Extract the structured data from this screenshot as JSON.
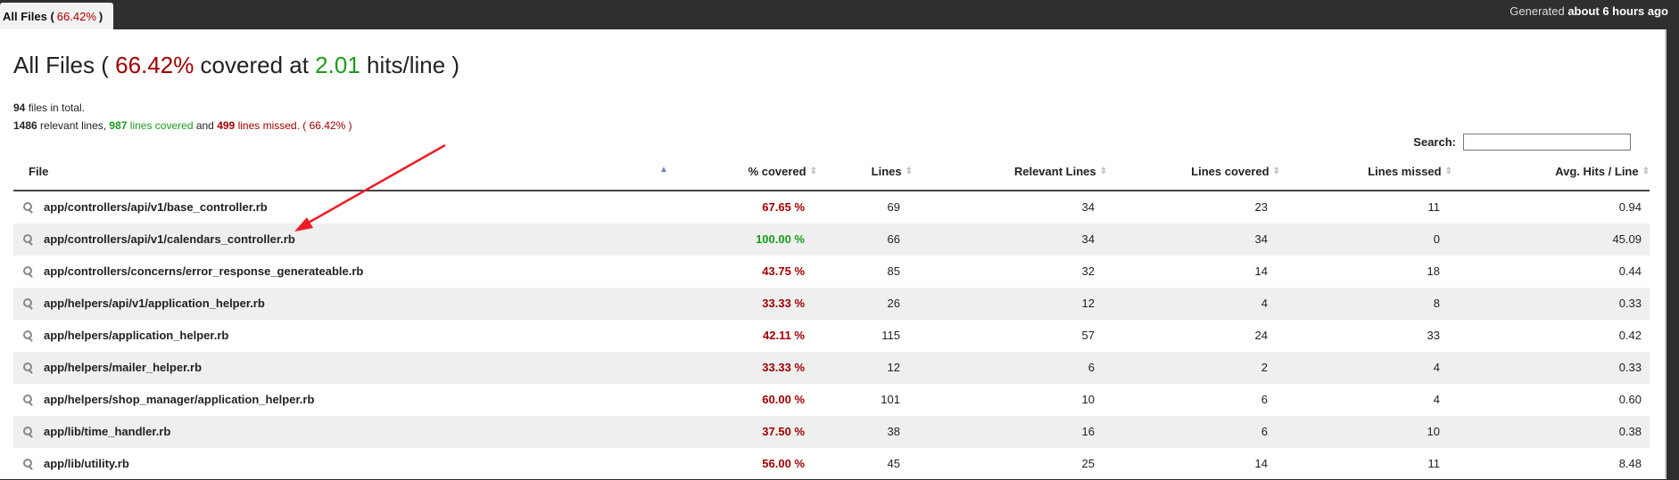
{
  "tab": {
    "label_prefix": "All Files (",
    "percent": "66.42%",
    "label_suffix": ")"
  },
  "generated": {
    "prefix": "Generated",
    "when": "about 6 hours ago"
  },
  "title": {
    "prefix": "All Files ( ",
    "percent": "66.42%",
    "middle": " covered at ",
    "hits": "2.01",
    "suffix": " hits/line )"
  },
  "summary": {
    "files_count": "94",
    "files_text": " files in total.",
    "relevant": "1486",
    "relevant_text": " relevant lines, ",
    "covered": "987",
    "covered_text": " lines covered",
    "and_text": " and ",
    "missed": "499",
    "missed_text": " lines missed.",
    "percent_text": " ( 66.42% )"
  },
  "search": {
    "label": "Search:",
    "value": ""
  },
  "columns": [
    "File",
    "% covered",
    "Lines",
    "Relevant Lines",
    "Lines covered",
    "Lines missed",
    "Avg. Hits / Line"
  ],
  "rows": [
    {
      "file": "app/controllers/api/v1/base_controller.rb",
      "covered": "67.65 %",
      "lines": "69",
      "relevant": "34",
      "lines_covered": "23",
      "missed": "11",
      "avg": "0.94"
    },
    {
      "file": "app/controllers/api/v1/calendars_controller.rb",
      "covered": "100.00 %",
      "lines": "66",
      "relevant": "34",
      "lines_covered": "34",
      "missed": "0",
      "avg": "45.09"
    },
    {
      "file": "app/controllers/concerns/error_response_generateable.rb",
      "covered": "43.75 %",
      "lines": "85",
      "relevant": "32",
      "lines_covered": "14",
      "missed": "18",
      "avg": "0.44"
    },
    {
      "file": "app/helpers/api/v1/application_helper.rb",
      "covered": "33.33 %",
      "lines": "26",
      "relevant": "12",
      "lines_covered": "4",
      "missed": "8",
      "avg": "0.33"
    },
    {
      "file": "app/helpers/application_helper.rb",
      "covered": "42.11 %",
      "lines": "115",
      "relevant": "57",
      "lines_covered": "24",
      "missed": "33",
      "avg": "0.42"
    },
    {
      "file": "app/helpers/mailer_helper.rb",
      "covered": "33.33 %",
      "lines": "12",
      "relevant": "6",
      "lines_covered": "2",
      "missed": "4",
      "avg": "0.33"
    },
    {
      "file": "app/helpers/shop_manager/application_helper.rb",
      "covered": "60.00 %",
      "lines": "101",
      "relevant": "10",
      "lines_covered": "6",
      "missed": "4",
      "avg": "0.60"
    },
    {
      "file": "app/lib/time_handler.rb",
      "covered": "37.50 %",
      "lines": "38",
      "relevant": "16",
      "lines_covered": "6",
      "missed": "10",
      "avg": "0.38"
    },
    {
      "file": "app/lib/utility.rb",
      "covered": "56.00 %",
      "lines": "45",
      "relevant": "25",
      "lines_covered": "14",
      "missed": "11",
      "avg": "8.48"
    }
  ],
  "colors": {
    "red": "#a10000",
    "green": "#1a9d1a",
    "arrow": "#ee1c25"
  }
}
